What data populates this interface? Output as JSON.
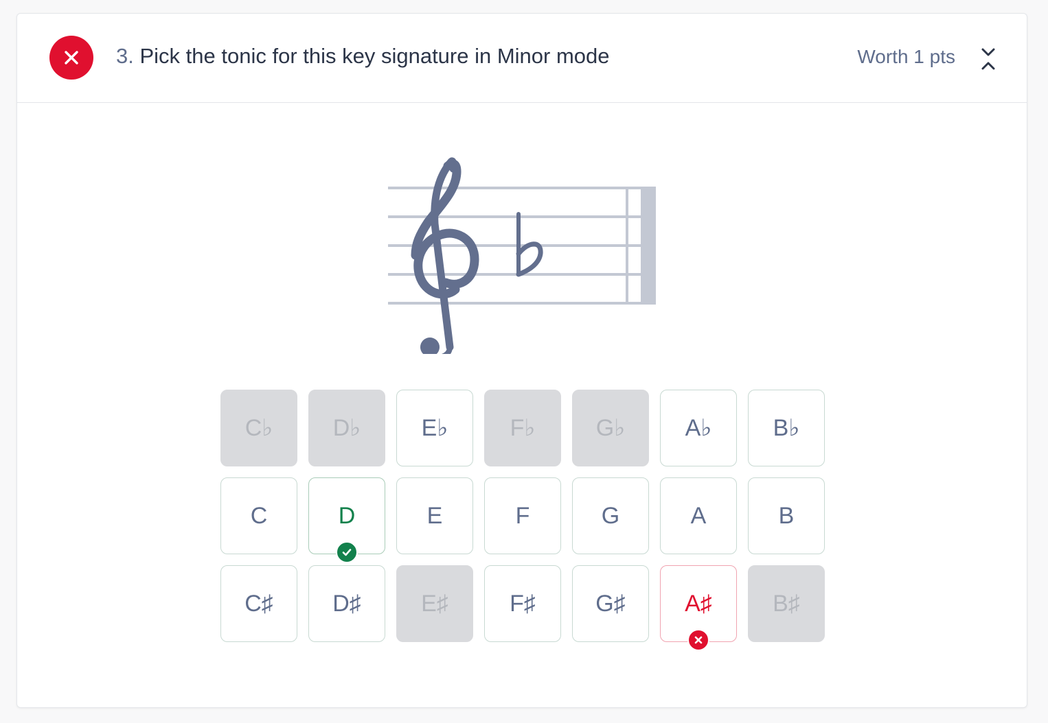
{
  "question": {
    "status": "incorrect",
    "number": "3.",
    "title": "Pick the tonic for this key signature in Minor mode",
    "worth": "Worth 1 pts"
  },
  "staff": {
    "clef": "treble",
    "key_signature": [
      "B♭"
    ],
    "clef_icon": "treble-clef-icon",
    "accidental_icon": "flat-icon"
  },
  "choices": {
    "flats": [
      {
        "label": "C♭",
        "state": "disabled"
      },
      {
        "label": "D♭",
        "state": "disabled"
      },
      {
        "label": "E♭",
        "state": "enabled"
      },
      {
        "label": "F♭",
        "state": "disabled"
      },
      {
        "label": "G♭",
        "state": "disabled"
      },
      {
        "label": "A♭",
        "state": "enabled"
      },
      {
        "label": "B♭",
        "state": "enabled"
      }
    ],
    "naturals": [
      {
        "label": "C",
        "state": "enabled"
      },
      {
        "label": "D",
        "state": "correct"
      },
      {
        "label": "E",
        "state": "enabled"
      },
      {
        "label": "F",
        "state": "enabled"
      },
      {
        "label": "G",
        "state": "enabled"
      },
      {
        "label": "A",
        "state": "enabled"
      },
      {
        "label": "B",
        "state": "enabled"
      }
    ],
    "sharps": [
      {
        "label": "C♯",
        "state": "enabled"
      },
      {
        "label": "D♯",
        "state": "enabled"
      },
      {
        "label": "E♯",
        "state": "disabled"
      },
      {
        "label": "F♯",
        "state": "enabled"
      },
      {
        "label": "G♯",
        "state": "enabled"
      },
      {
        "label": "A♯",
        "state": "wrong"
      },
      {
        "label": "B♯",
        "state": "disabled"
      }
    ]
  },
  "colors": {
    "error": "#e0102f",
    "success": "#12814c",
    "text": "#5f6d8c",
    "disabled_bg": "#d9dadd"
  }
}
